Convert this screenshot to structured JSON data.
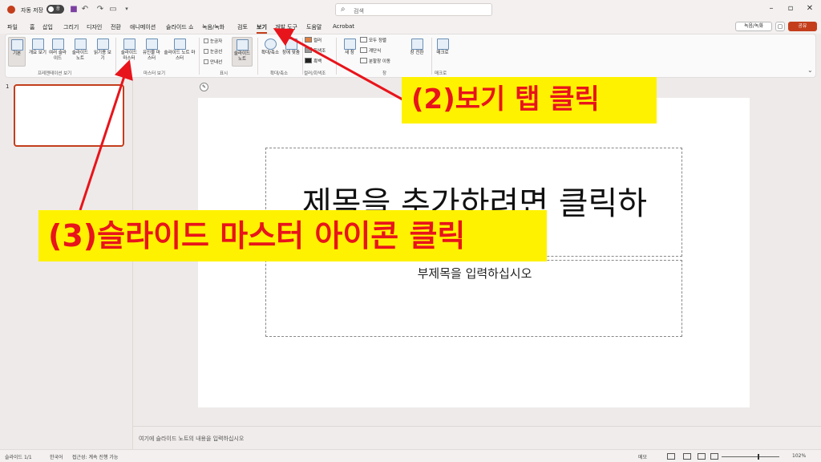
{
  "titlebar": {
    "autosave_label": "자동 저장",
    "autosave_state": "끔",
    "search_placeholder": "검색",
    "qat_icons": [
      "save-icon",
      "undo-icon",
      "redo-icon",
      "presentation-icon",
      "customize-icon"
    ],
    "window_icons": [
      "minimize-icon",
      "restore-icon",
      "close-icon"
    ]
  },
  "tabs": {
    "items": [
      "파일",
      "홈",
      "삽입",
      "그리기",
      "디자인",
      "전환",
      "애니메이션",
      "슬라이드 쇼",
      "녹음/녹화",
      "검토",
      "보기",
      "개발 도구",
      "도움말",
      "Acrobat"
    ],
    "active": "보기",
    "record_label": "녹음/녹화",
    "share_label": "공유"
  },
  "ribbon": {
    "presentation_views": [
      "기본",
      "개요 보기",
      "여러 슬라이드",
      "슬라이드 노트",
      "읽기용 보기"
    ],
    "presentation_views_label": "프레젠테이션 보기",
    "master_views": [
      "슬라이드 마스터",
      "유인물 마스터",
      "슬라이드 노트 마스터"
    ],
    "master_views_label": "마스터 보기",
    "show_checks": [
      "눈금자",
      "눈금선",
      "안내선"
    ],
    "notes_button": "슬라이드 노트",
    "show_label": "표시",
    "zoom_buttons": [
      "확대/축소",
      "창에 맞춤"
    ],
    "zoom_label": "확대/축소",
    "color_options": [
      "컬러",
      "회색조",
      "흑백"
    ],
    "color_label": "컬러/회색조",
    "window_new": "새 창",
    "window_items": [
      "모두 정렬",
      "계단식",
      "분할창 이동"
    ],
    "switch_window": "창 전환",
    "window_label": "창",
    "macro": "매크로",
    "macro_label": "매크로"
  },
  "pane": {
    "slide_number": "1"
  },
  "slide": {
    "title_placeholder": "제목을 추가하려면 클릭하",
    "subtitle_placeholder": "부제목을 입력하십시오"
  },
  "notes": {
    "placeholder": "여기에 슬라이드 노트의 내용을 입력하십시오"
  },
  "status": {
    "slide_count": "슬라이드 1/1",
    "language": "한국어",
    "accessibility": "접근성: 계속 진행 가능",
    "notes_label": "메모",
    "zoom": "102%"
  },
  "annotations": {
    "step2": "(2)보기 탭 클릭",
    "step3": "(3)슬라이드 마스터 아이콘 클릭",
    "highlight_color": "#fff200",
    "text_color": "#e8141b"
  }
}
